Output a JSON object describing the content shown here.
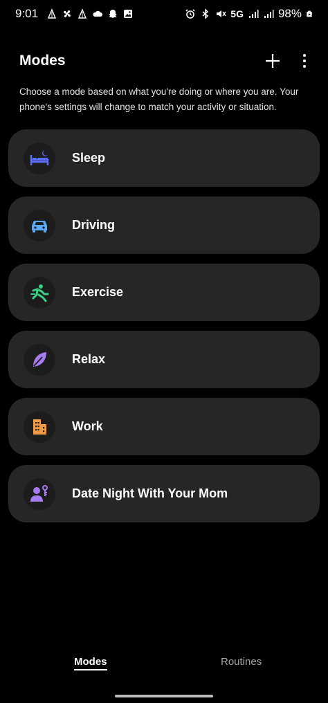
{
  "status": {
    "time": "9:01",
    "network": "5G",
    "battery": "98%"
  },
  "header": {
    "title": "Modes"
  },
  "description": "Choose a mode based on what you're doing or where you are. Your phone's settings will change to match your activity or situation.",
  "modes": [
    {
      "label": "Sleep",
      "icon": "bed-moon-icon",
      "color": "#5b6cf6"
    },
    {
      "label": "Driving",
      "icon": "car-icon",
      "color": "#5aa9f2"
    },
    {
      "label": "Exercise",
      "icon": "running-person-icon",
      "color": "#39d089"
    },
    {
      "label": "Relax",
      "icon": "leaf-icon",
      "color": "#a77cf0"
    },
    {
      "label": "Work",
      "icon": "building-icon",
      "color": "#f29b45"
    },
    {
      "label": "Date Night With Your Mom",
      "icon": "person-key-icon",
      "color": "#a77cf0"
    }
  ],
  "nav": {
    "modes_label": "Modes",
    "routines_label": "Routines"
  }
}
